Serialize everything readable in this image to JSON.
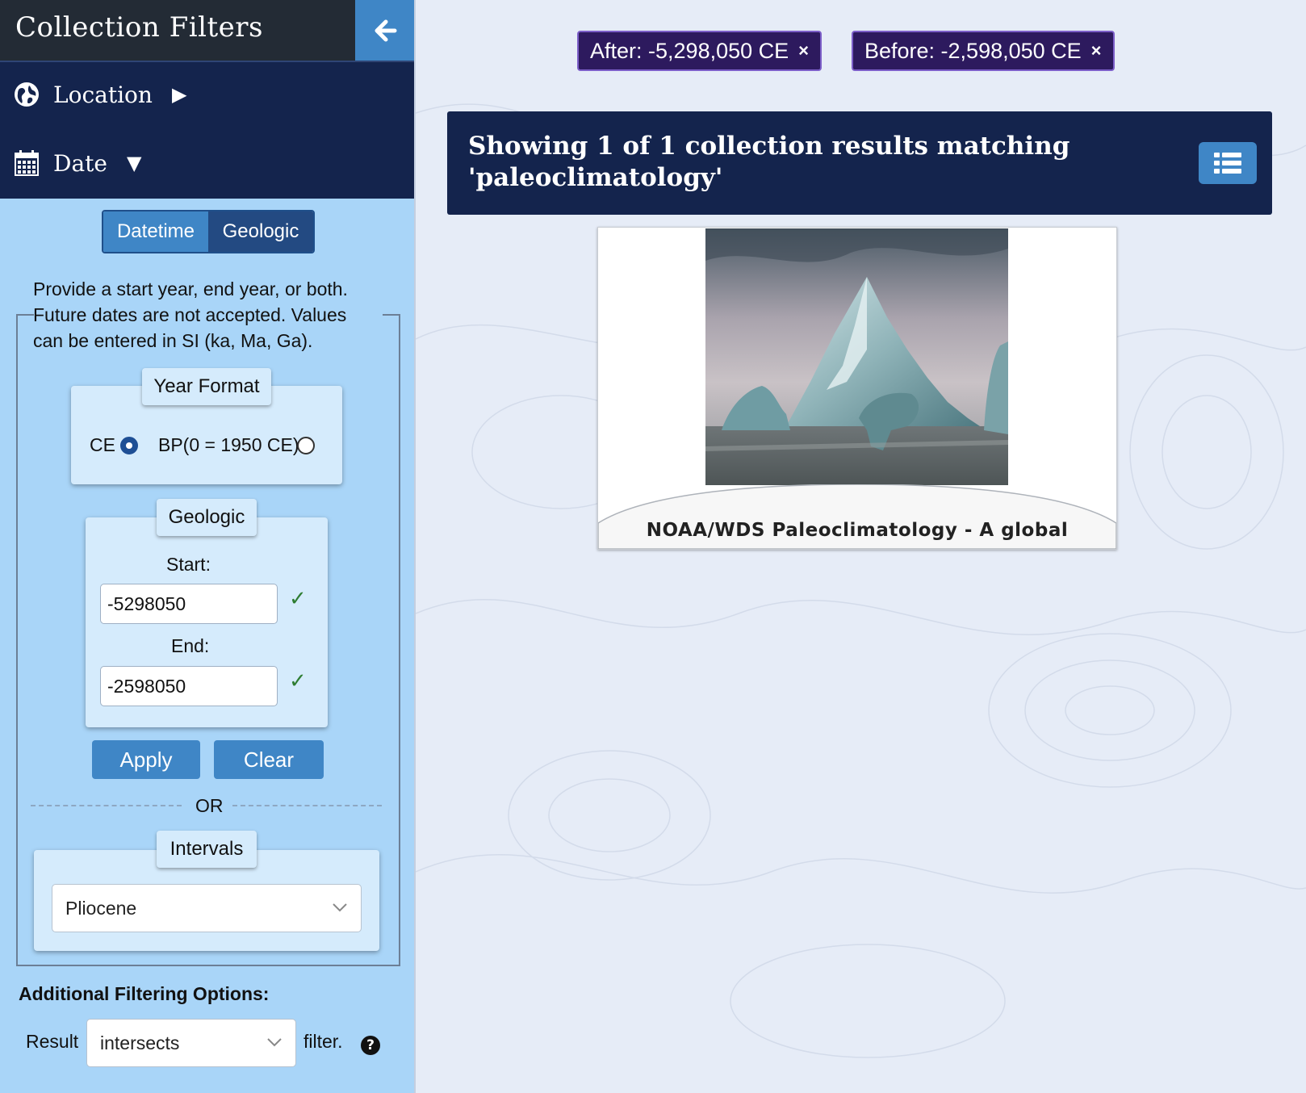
{
  "sidebar": {
    "title": "Collection Filters",
    "nav": {
      "location_label": "Location",
      "location_arrow": "▶",
      "date_label": "Date",
      "date_arrow": "▼"
    },
    "mode_tabs": [
      "Datetime",
      "Geologic"
    ],
    "active_mode": "Geologic",
    "help_text": "Provide a start year, end year, or both. Future dates are not accepted. Values can be entered in SI (ka, Ma, Ga).",
    "year_format": {
      "title": "Year Format",
      "ce_label": "CE",
      "bp_label": "BP(0 = 1950 CE)",
      "selected": "CE"
    },
    "geologic": {
      "title": "Geologic",
      "start_label": "Start:",
      "start_value": "-5298050",
      "end_label": "End:",
      "end_value": "-2598050",
      "valid_mark": "✓"
    },
    "apply_label": "Apply",
    "clear_label": "Clear",
    "or_label": "OR",
    "intervals": {
      "title": "Intervals",
      "selected": "Pliocene"
    },
    "additional": {
      "title": "Additional Filtering Options:",
      "result_label": "Result",
      "result_select": "intersects",
      "filter_label": "filter.",
      "help_glyph": "?"
    }
  },
  "main": {
    "chips": [
      {
        "label": "After: -5,298,050 CE",
        "remove": "×"
      },
      {
        "label": "Before: -2,598,050 CE",
        "remove": "×"
      }
    ],
    "results_text": "Showing 1 of 1 collection results matching 'paleoclimatology'",
    "card": {
      "title": "NOAA/WDS Paleoclimatology - A global"
    }
  },
  "colors": {
    "sidebar_bg": "#a9d5f8",
    "header_dark": "#232b35",
    "nav_navy": "#14244d",
    "accent_blue": "#3f86c6",
    "chip_purple": "#2d1a5e",
    "valid_green": "#2e7d32"
  },
  "icons": {
    "back": "arrow-left-icon",
    "location": "globe-icon",
    "date": "calendar-icon",
    "list_view": "list-icon",
    "dropdown": "chevron-down-icon",
    "help": "question-circle-icon"
  }
}
